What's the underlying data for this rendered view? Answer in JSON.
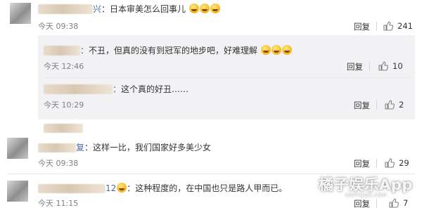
{
  "comments": [
    {
      "name_tail": "兴",
      "text": "：日本审美怎么回事儿",
      "emoji_count": 3,
      "time": "今天 09:38",
      "reply_label": "回复",
      "likes": "241"
    },
    {
      "name_tail": "：",
      "text": "不丑，但真的没有到冠军的地步吧，好难理解",
      "emoji_count": 3,
      "time": "今天 12:46",
      "reply_label": "回复",
      "likes": "10"
    },
    {
      "name_tail": "：",
      "text": "这个真的好丑……",
      "emoji_count": 0,
      "time": "今天 10:29",
      "reply_label": "回复",
      "likes": "2"
    },
    {
      "name_tail": "复",
      "text": "：这样一比，我们国家好多美少女",
      "emoji_count": 0,
      "time": "今天 09:38",
      "reply_label": "回复",
      "likes": "29"
    },
    {
      "name_tail": "12",
      "text": "：这种程度的，在中国也只是路人甲而已。",
      "emoji_count": 0,
      "time": "今天 11:15",
      "reply_label": "回复",
      "likes": "7"
    }
  ],
  "watermark": {
    "title": "橘子娱乐App",
    "sub": "HAPPYJUZI.COM"
  },
  "icons": {
    "like": "thumbs-up-icon",
    "emoji": "grin-emoji-icon"
  }
}
